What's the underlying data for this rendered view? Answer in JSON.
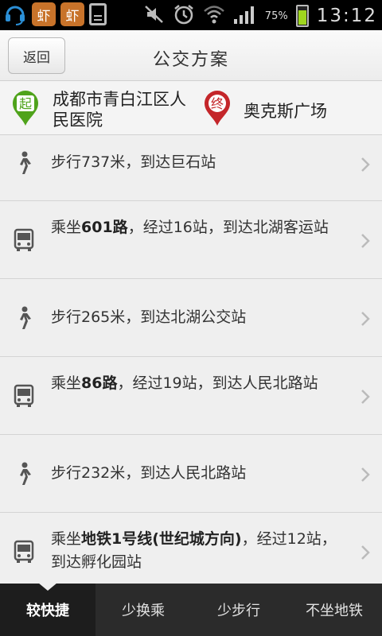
{
  "status_bar": {
    "app_icon_1": "虾",
    "app_icon_2": "虾",
    "battery_percent": "75%",
    "time": "13:12",
    "accent_battery": "#9fd61e"
  },
  "header": {
    "back_label": "返回",
    "title": "公交方案"
  },
  "route": {
    "start_badge": "起",
    "start_name": "成都市青白江区人民医院",
    "end_badge": "终",
    "end_name": "奥克斯广场",
    "start_color": "#4fa31b",
    "end_color": "#c4262a"
  },
  "steps": [
    {
      "type": "walk",
      "icon": "walk-icon",
      "text_before": "步行737米，到达巨石站",
      "bold": "",
      "text_after": ""
    },
    {
      "type": "bus",
      "icon": "bus-icon",
      "text_before": "乘坐",
      "bold": "601路",
      "text_after": "，经过16站，到达北湖客运站"
    },
    {
      "type": "walk",
      "icon": "walk-icon",
      "text_before": "步行265米，到达北湖公交站",
      "bold": "",
      "text_after": ""
    },
    {
      "type": "bus",
      "icon": "bus-icon",
      "text_before": "乘坐",
      "bold": "86路",
      "text_after": "，经过19站，到达人民北路站"
    },
    {
      "type": "walk",
      "icon": "walk-icon",
      "text_before": "步行232米，到达人民北路站",
      "bold": "",
      "text_after": ""
    },
    {
      "type": "bus",
      "icon": "bus-icon",
      "text_before": "乘坐",
      "bold": "地铁1号线(世纪城方向)",
      "text_after": "，经过12站，到达孵化园站"
    }
  ],
  "tabs": [
    {
      "label": "较快捷",
      "active": true
    },
    {
      "label": "少换乘",
      "active": false
    },
    {
      "label": "少步行",
      "active": false
    },
    {
      "label": "不坐地铁",
      "active": false
    }
  ]
}
